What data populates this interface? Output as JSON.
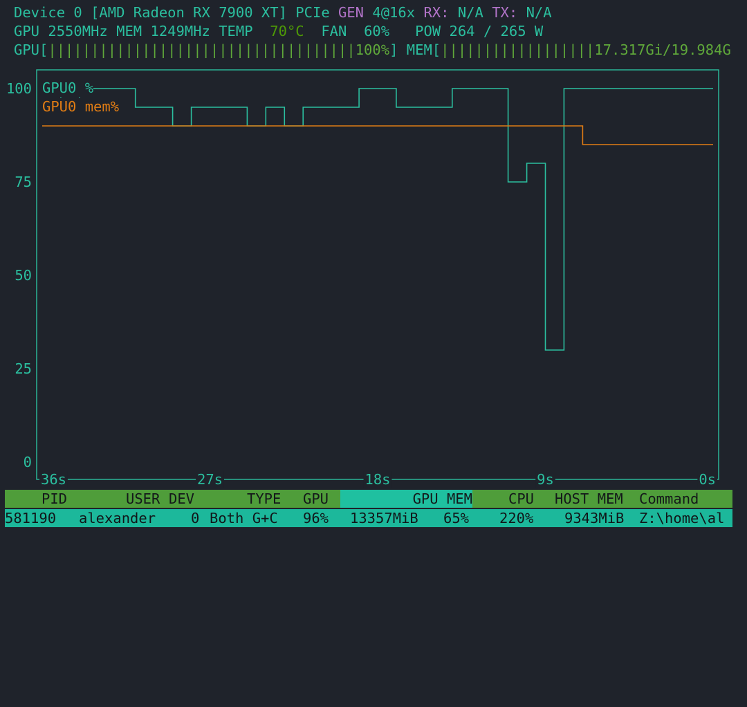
{
  "device": {
    "name_prefix": "Device 0 [AMD Radeon RX 7900 XT] PCIe ",
    "gen_label": "GEN",
    "gen_value": "4@16x",
    "rx_label": "RX:",
    "rx_value": "N/A",
    "tx_label": "TX:",
    "tx_value": "N/A"
  },
  "stats": {
    "gpu_clock": "GPU 2550MHz",
    "mem_clock": "MEM 1249MHz",
    "temp_label": "TEMP",
    "temp_value": "70°C",
    "fan_label": "FAN",
    "fan_value": "60%",
    "pow_label": "POW",
    "pow_value": "264 / 265 W"
  },
  "meters": {
    "gpu_label": "GPU[",
    "gpu_value": "100%",
    "gpu_fraction": 1.0,
    "mem_label": "MEM[",
    "mem_value": "17.317Gi/19.984G",
    "mem_fraction": 0.867
  },
  "chart_data": {
    "type": "line",
    "y_ticks": [
      "100",
      "75",
      "50",
      "25",
      "0"
    ],
    "x_ticks": [
      "36s",
      "27s",
      "18s",
      "9s",
      "0s"
    ],
    "ylim": [
      0,
      100
    ],
    "xlim": [
      36,
      0
    ],
    "legend_placement": "top-left",
    "colors": {
      "gpu": "#2bbf9f",
      "mem": "#e07c14",
      "axis": "#2bbf9f"
    },
    "series": [
      {
        "name": "GPU0 %",
        "x": [
          36,
          35,
          35,
          34,
          34,
          31,
          31,
          29,
          29,
          28,
          28,
          25,
          25,
          24,
          24,
          23,
          23,
          22,
          22,
          19,
          19,
          17,
          17,
          14,
          14,
          11,
          11,
          10,
          10,
          9,
          9,
          8,
          8,
          7,
          7,
          0
        ],
        "values": [
          100,
          100,
          95,
          95,
          100,
          100,
          95,
          95,
          90,
          90,
          95,
          95,
          90,
          90,
          95,
          95,
          90,
          90,
          95,
          95,
          100,
          100,
          95,
          95,
          100,
          100,
          75,
          75,
          80,
          80,
          30,
          30,
          100,
          100,
          100,
          100
        ]
      },
      {
        "name": "GPU0 mem%",
        "x": [
          36,
          7,
          7,
          0
        ],
        "values": [
          90,
          90,
          85,
          85
        ]
      }
    ]
  },
  "table": {
    "headers": {
      "pid": "PID",
      "user": "USER",
      "dev": "DEV",
      "type": "TYPE",
      "gpu": "GPU",
      "gpu_mem": "GPU MEM",
      "cpu": "CPU",
      "host_mem": "HOST MEM",
      "command": "Command"
    },
    "rows": [
      {
        "pid": "581190",
        "user": "alexander",
        "dev": "0",
        "type": "Both G+C",
        "gpu": "96%",
        "gpu_mem": "13357MiB",
        "gpu_mem_pct": "65%",
        "cpu": "220%",
        "host_mem": "9343MiB",
        "command": "Z:\\home\\al"
      }
    ]
  }
}
